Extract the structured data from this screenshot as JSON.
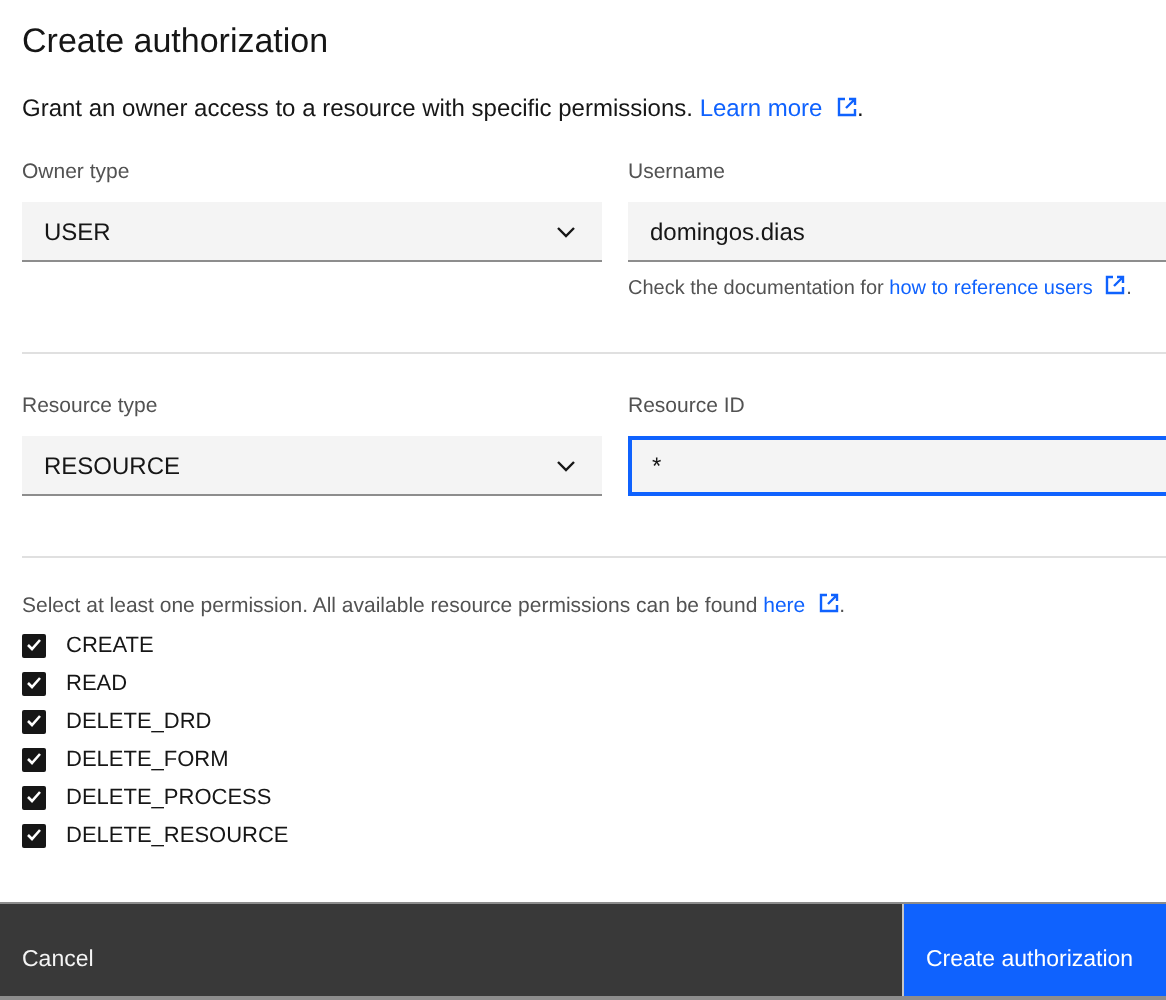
{
  "title": "Create authorization",
  "description": {
    "text": "Grant an owner access to a resource with specific permissions. ",
    "link": "Learn more",
    "after": "."
  },
  "owner_type": {
    "label": "Owner type",
    "value": "USER"
  },
  "username": {
    "label": "Username",
    "value": "domingos.dias",
    "focused": false,
    "helper": {
      "text": "Check the documentation for ",
      "link": "how to reference users",
      "after": "."
    }
  },
  "resource_type": {
    "label": "Resource type",
    "value": "RESOURCE"
  },
  "resource_id": {
    "label": "Resource ID",
    "value": "*",
    "focused": true
  },
  "permissions": {
    "hint": {
      "text": "Select at least one permission. All available resource permissions can be found ",
      "link": "here",
      "after": "."
    },
    "items": [
      {
        "label": "CREATE",
        "checked": true
      },
      {
        "label": "READ",
        "checked": true
      },
      {
        "label": "DELETE_DRD",
        "checked": true
      },
      {
        "label": "DELETE_FORM",
        "checked": true
      },
      {
        "label": "DELETE_PROCESS",
        "checked": true
      },
      {
        "label": "DELETE_RESOURCE",
        "checked": true
      }
    ]
  },
  "footer": {
    "cancel": "Cancel",
    "primary": "Create authorization"
  }
}
